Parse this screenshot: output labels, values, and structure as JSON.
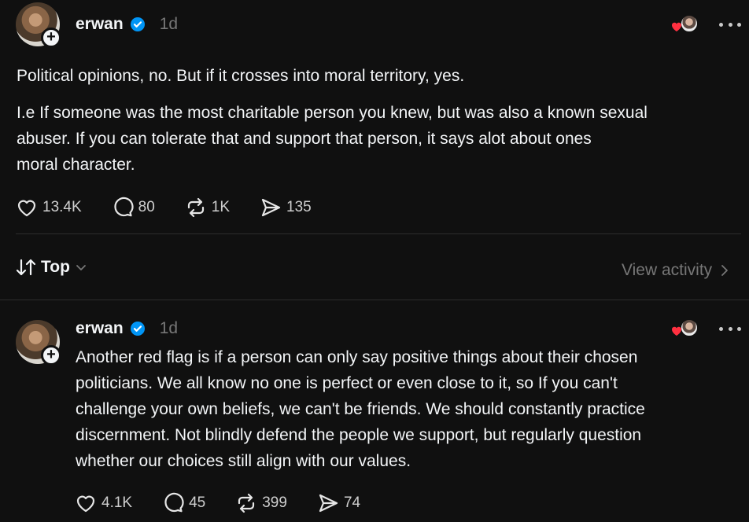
{
  "post": {
    "username": "erwan",
    "time": "1d",
    "paragraph1": "Political opinions, no. But if it crosses into moral territory, yes.",
    "paragraph2_line1": "I.e If someone was the most charitable person you knew, but was also a known sexual",
    "paragraph2_line2": "abuser. If you can tolerate that and support that person, it says alot about ones",
    "paragraph2_line3": "moral character.",
    "likes": "13.4K",
    "replies": "80",
    "reposts": "1K",
    "shares": "135"
  },
  "sort_bar": {
    "label": "Top",
    "view_activity": "View activity"
  },
  "reply": {
    "username": "erwan",
    "time": "1d",
    "line1": "Another red flag is if a person can only say positive things about their chosen",
    "line2": "politicians. We all know no one is perfect or even close to it, so If you can't",
    "line3": "challenge your own beliefs, we can't be friends. We should constantly practice",
    "line4": "discernment. Not blindly defend the people we support, but regularly question",
    "line5": "whether our choices still align with our values.",
    "likes": "4.1K",
    "replies": "45",
    "reposts": "399",
    "shares": "74"
  },
  "colors": {
    "background": "#101010",
    "text": "#f3f5f7",
    "muted": "#777777",
    "verified": "#0095f6",
    "heart": "#ff3040"
  },
  "icons": {
    "verified": "verified-badge-icon",
    "like": "heart-icon",
    "reply": "comment-bubble-icon",
    "repost": "repost-icon",
    "share": "send-icon",
    "sort": "sort-arrows-icon",
    "more": "more-dots-icon"
  }
}
